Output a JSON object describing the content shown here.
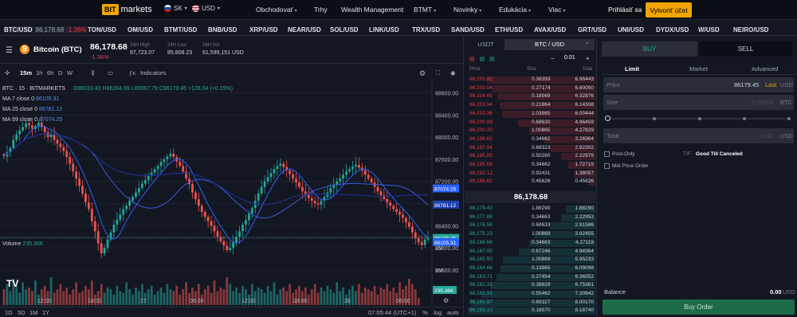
{
  "header": {
    "logo_bit": "BIT",
    "logo_text": "markets",
    "lang": "SK",
    "currency": "USD",
    "nav": [
      "Obchodovať",
      "Trhy",
      "Wealth Management",
      "BTMT",
      "Novinky",
      "Edukácia",
      "Viac"
    ],
    "login": "Prihlásiť sa",
    "signup": "Vytvoriť účet"
  },
  "ticker": [
    {
      "sym": "BTC/USD",
      "price": "86,178.68",
      "chg": "-1.36%"
    },
    {
      "sym": "TON/USD"
    },
    {
      "sym": "OM/USD"
    },
    {
      "sym": "BTMT/USD"
    },
    {
      "sym": "BNB/USD"
    },
    {
      "sym": "XRP/USD"
    },
    {
      "sym": "NEAR/USD"
    },
    {
      "sym": "SOL/USD"
    },
    {
      "sym": "LINK/USD"
    },
    {
      "sym": "TRX/USD"
    },
    {
      "sym": "SAND/USD"
    },
    {
      "sym": "ETH/USD"
    },
    {
      "sym": "AVAX/USD"
    },
    {
      "sym": "GRT/USD"
    },
    {
      "sym": "UNI/USD"
    },
    {
      "sym": "DYDX/USD"
    },
    {
      "sym": "W/USD"
    },
    {
      "sym": "NEIRO/USD"
    }
  ],
  "symbol": {
    "name": "Bitcoin (BTC)",
    "price": "86,178.68",
    "change": "-1.36%",
    "high_label": "24H High",
    "high": "87,723.07",
    "low_label": "24H Low",
    "low": "85,808.23",
    "vol_label": "24H Vol",
    "vol": "61,599,151 USD"
  },
  "toolbar": {
    "intervals": [
      "15m",
      "1h",
      "6h",
      "D",
      "W"
    ],
    "indicators": "Indicators"
  },
  "chart_legend": {
    "title": "BTC · 15 · BITMARKETS",
    "ohlc": "O86033.43 H86264.69 L85967.79 C86179.45 +128.04 (+0.15%)",
    "ma7": "MA 7 close 0",
    "ma7v": "86105.31",
    "ma25": "MA 25 close 0",
    "ma25v": "86781.12",
    "ma99": "MA 99 close 0",
    "ma99v": "87074.25",
    "volume": "Volume",
    "volumev": "235.36K"
  },
  "chart_data": {
    "type": "candlestick",
    "price_axis": [
      "88800.00",
      "88400.00",
      "88000.00",
      "87600.00",
      "87200.00",
      "86800.00",
      "86400.00",
      "86000.00",
      "85600.00"
    ],
    "price_range": [
      85500,
      88950
    ],
    "price_tags": [
      {
        "v": 87074.25,
        "label": "87074.25",
        "color": "#2962ff"
      },
      {
        "v": 86781.12,
        "label": "86781.12",
        "color": "#1e40af"
      },
      {
        "v": 86179.45,
        "label": "86179.45",
        "color": "#26a69a"
      },
      {
        "v": 86105.31,
        "label": "86105.31",
        "color": "#2962ff"
      }
    ],
    "vol_axis": [
      "2M",
      "1M"
    ],
    "vol_tag": "235.36K",
    "time_axis": [
      "12:00",
      "18:00",
      "27",
      "06:00",
      "12:00",
      "18:00",
      "28",
      "06:00"
    ],
    "closes": [
      87650,
      87720,
      87800,
      87950,
      88050,
      88120,
      88180,
      88250,
      88210,
      88150,
      88200,
      88260,
      88180,
      88090,
      88000,
      88050,
      87950,
      87880,
      87820,
      87750,
      87640,
      87520,
      87380,
      87250,
      87120,
      86980,
      86820,
      86700,
      86480,
      86300,
      86080,
      85900,
      86000,
      86150,
      86280,
      86420,
      86510,
      86600,
      86700,
      86760,
      86850,
      86920,
      87000,
      87080,
      87160,
      87220,
      87300,
      87360,
      87420,
      87480,
      87550,
      87600,
      87650,
      87700,
      87640,
      87560,
      87480,
      87380,
      87250,
      87150,
      87000,
      86880,
      86760,
      86650,
      86560,
      86480,
      86400,
      86300,
      86200,
      86120,
      86040,
      85960,
      86000,
      86100,
      86200,
      86300,
      86420,
      86500,
      86620,
      86720,
      86850,
      86980,
      87100,
      87200,
      87280,
      87350,
      87420,
      87480,
      87520,
      87460,
      87400,
      87330,
      87250,
      87180,
      87100,
      87020,
      86960,
      86900,
      86850,
      86800,
      86780,
      86850,
      86920,
      87000,
      87080,
      87140,
      87200,
      87250,
      87320,
      87380,
      87420,
      87470,
      87500,
      87450,
      87400,
      87320,
      87250,
      87180,
      87100,
      87020,
      86950,
      86880,
      86820,
      86760,
      86700,
      86650,
      86600,
      86540,
      86460,
      86380,
      86280,
      86180,
      86100,
      86050,
      86150,
      86179
    ],
    "volumes": [
      0.9,
      1.2,
      0.8,
      1.5,
      1.1,
      0.7,
      1.3,
      0.9,
      1.0,
      0.8,
      1.4,
      0.6,
      0.9,
      1.1,
      0.8,
      1.6,
      0.7,
      0.9,
      1.2,
      0.8,
      1.0,
      0.6,
      0.9,
      1.3,
      0.7,
      0.8,
      1.1,
      0.9,
      1.4,
      0.6,
      0.8,
      1.2,
      0.7,
      1.0,
      0.9,
      0.6,
      1.1,
      0.8,
      0.7,
      1.3,
      0.9,
      0.6,
      1.0,
      0.8,
      1.2,
      0.7,
      0.9,
      1.1,
      0.6,
      0.8,
      1.0,
      0.7,
      1.2,
      0.9,
      0.8,
      1.1,
      0.6,
      0.9,
      1.3,
      0.7,
      1.0,
      0.8,
      1.2,
      0.6,
      0.9,
      1.1,
      0.7,
      1.4,
      0.8,
      1.0,
      0.9,
      1.6,
      1.2,
      0.8,
      1.0,
      0.7,
      1.1,
      0.9,
      0.6,
      1.2,
      0.8,
      1.0,
      0.9,
      0.7,
      1.1,
      0.8,
      1.3,
      0.6,
      0.9,
      1.0,
      0.8,
      1.2,
      0.7,
      0.9,
      1.1,
      0.8,
      1.0,
      0.6,
      0.9,
      1.2,
      0.7,
      1.0,
      0.8,
      1.1,
      0.9,
      0.7,
      1.3,
      0.8,
      1.0,
      0.6,
      0.9,
      1.1,
      0.8,
      1.2,
      0.7,
      1.0,
      0.9,
      0.8,
      1.1,
      0.6,
      1.0,
      0.9,
      1.2,
      0.8,
      1.0,
      0.7,
      1.3,
      0.9,
      1.1,
      1.5,
      1.2,
      0.9,
      0.4
    ]
  },
  "bottom": {
    "ranges": [
      "1D",
      "5D",
      "1M",
      "1Y"
    ],
    "time": "07:05:44 (UTC+1)",
    "pct": "%",
    "log": "log",
    "auto": "auto"
  },
  "book": {
    "tab_usdt": "USDT",
    "tab_btc": "BTC / USD",
    "step": "0.01",
    "col_price": "Price",
    "col_size": "Size",
    "col_total": "Total",
    "mid": "86,178.68",
    "asks": [
      [
        "86,205.82",
        "0.36393",
        "6.96443"
      ],
      [
        "86,205.04",
        "0.27174",
        "6.60050"
      ],
      [
        "86,204.65",
        "0.18568",
        "6.32876"
      ],
      [
        "86,203.94",
        "0.21864",
        "6.14308"
      ],
      [
        "86,203.36",
        "1.03985",
        "6.00444"
      ],
      [
        "86,200.99",
        "0.68630",
        "4.96459"
      ],
      [
        "86,200.20",
        "1.00865",
        "4.27829"
      ],
      [
        "86,198.62",
        "0.34662",
        "3.26964"
      ],
      [
        "86,197.94",
        "0.69323",
        "2.92302"
      ],
      [
        "86,195.85",
        "0.50260",
        "2.22979"
      ],
      [
        "86,195.68",
        "0.34662",
        "1.72719"
      ],
      [
        "86,192.12",
        "0.92431",
        "1.38057"
      ],
      [
        "86,188.62",
        "0.45626",
        "0.45626"
      ]
    ],
    "bids": [
      [
        "86,179.43",
        "1.88290",
        "1.88290"
      ],
      [
        "86,177.88",
        "0.34663",
        "2.22953"
      ],
      [
        "86,176.56",
        "0.68633",
        "2.91586"
      ],
      [
        "86,175.23",
        "1.00869",
        "3.92455"
      ],
      [
        "86,168.66",
        "0.34663",
        "4.27118"
      ],
      [
        "86,167.00",
        "0.67246",
        "4.94364"
      ],
      [
        "86,165.50",
        "1.00869",
        "5.95233"
      ],
      [
        "86,164.66",
        "0.13865",
        "6.09098"
      ],
      [
        "86,163.71",
        "0.27454",
        "6.36552"
      ],
      [
        "86,162.31",
        "0.38829",
        "6.75381"
      ],
      [
        "86,161.16",
        "0.55462",
        "7.30842"
      ],
      [
        "86,160.97",
        "0.69327",
        "8.00170"
      ],
      [
        "86,158.10",
        "0.18570",
        "8.18740"
      ]
    ]
  },
  "order": {
    "buy": "BUY",
    "sell": "SELL",
    "types": [
      "Limit",
      "Market",
      "Advanced"
    ],
    "price_label": "Price",
    "price_value": "86179.45",
    "price_last": "Last",
    "price_unit": "USD",
    "size_label": "Size",
    "size_hint": "0.00000",
    "size_unit": "BTC",
    "total_label": "Total",
    "total_hint": "0.00",
    "total_unit": "USD",
    "post_only": "Post-Only",
    "tif_label": "TIF",
    "tif_value": "Good Till Canceled",
    "mid_price": "Mid Price Order",
    "balance_label": "Balance",
    "balance_value": "0.00",
    "balance_unit": "USD",
    "buy_order": "Buy Order"
  }
}
